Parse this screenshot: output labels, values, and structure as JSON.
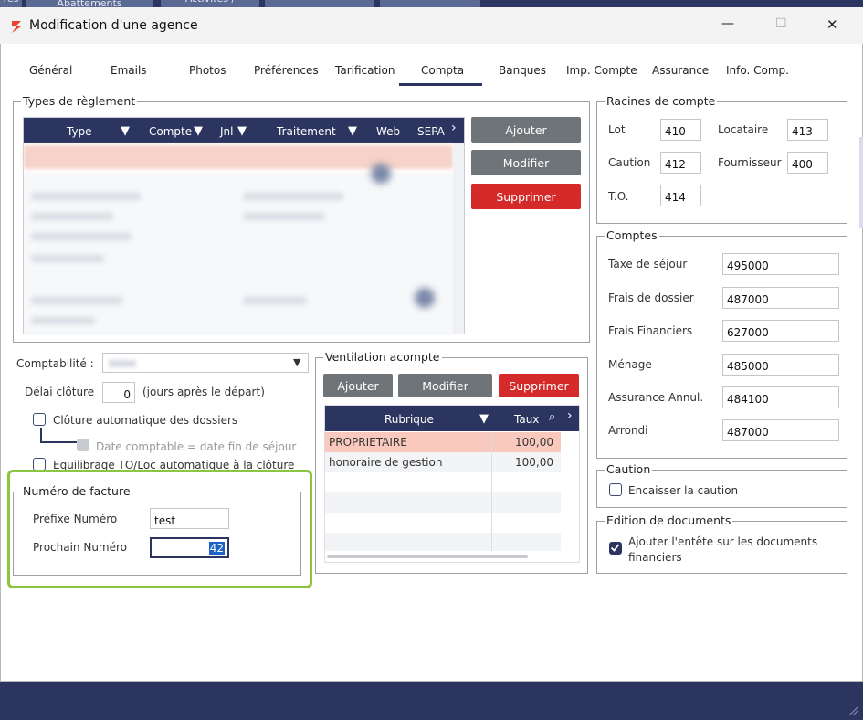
{
  "background_tabs": [
    "res",
    "Abattements",
    "Activités /"
  ],
  "window": {
    "title": "Modification d'une agence",
    "controls": {
      "minimize": "—",
      "maximize": "☐",
      "close": "✕"
    }
  },
  "tabs": [
    {
      "label": "Général"
    },
    {
      "label": "Emails"
    },
    {
      "label": "Photos"
    },
    {
      "label": "Préférences"
    },
    {
      "label": "Tarification"
    },
    {
      "label": "Compta"
    },
    {
      "label": "Banques"
    },
    {
      "label": "Imp. Compte"
    },
    {
      "label": "Assurance"
    },
    {
      "label": "Info. Comp."
    }
  ],
  "types_reglement": {
    "legend": "Types de règlement",
    "columns": [
      "Type",
      "Compte",
      "Jnl",
      "Traitement",
      "Web",
      "SEPA"
    ],
    "buttons": {
      "add": "Ajouter",
      "edit": "Modifier",
      "delete": "Supprimer"
    }
  },
  "comptabilite": {
    "label": "Comptabilité :",
    "delai_label": "Délai clôture",
    "delai_value": "0",
    "delai_suffix": "(jours après le départ)",
    "cloture_auto": "Clôture automatique des dossiers",
    "date_comptable": "Date comptable = date fin de séjour",
    "equilibrage": "Equilibrage TO/Loc automatique à la clôture"
  },
  "numero_facture": {
    "legend": "Numéro de facture",
    "prefix_label": "Préfixe Numéro",
    "prefix_value": "test",
    "next_label": "Prochain Numéro",
    "next_value": "42"
  },
  "ventilation": {
    "legend": "Ventilation acompte",
    "buttons": {
      "add": "Ajouter",
      "edit": "Modifier",
      "delete": "Supprimer"
    },
    "columns": [
      "Rubrique",
      "Taux"
    ],
    "rows": [
      {
        "rubrique": "PROPRIETAIRE",
        "taux": "100,00"
      },
      {
        "rubrique": "honoraire de gestion",
        "taux": "100,00"
      }
    ]
  },
  "racines": {
    "legend": "Racines de compte",
    "lot_label": "Lot",
    "lot_value": "410",
    "locataire_label": "Locataire",
    "locataire_value": "413",
    "caution_label": "Caution",
    "caution_value": "412",
    "fournisseur_label": "Fournisseur",
    "fournisseur_value": "400",
    "to_label": "T.O.",
    "to_value": "414"
  },
  "comptes": {
    "legend": "Comptes",
    "rows": [
      {
        "label": "Taxe de séjour",
        "value": "495000"
      },
      {
        "label": "Frais de dossier",
        "value": "487000"
      },
      {
        "label": "Frais Financiers",
        "value": "627000"
      },
      {
        "label": "Ménage",
        "value": "485000"
      },
      {
        "label": "Assurance Annul.",
        "value": "484100"
      },
      {
        "label": "Arrondi",
        "value": "487000"
      }
    ]
  },
  "caution": {
    "legend": "Caution",
    "checkbox": "Encaisser la caution"
  },
  "edition": {
    "legend": "Edition de documents",
    "checkbox_line1": "Ajouter l'entête sur les documents",
    "checkbox_line2": "financiers"
  },
  "colors": {
    "accent": "#2b3560",
    "danger": "#d42a2a",
    "highlight": "#8cc63f",
    "row_selected": "#f9c9bd"
  }
}
